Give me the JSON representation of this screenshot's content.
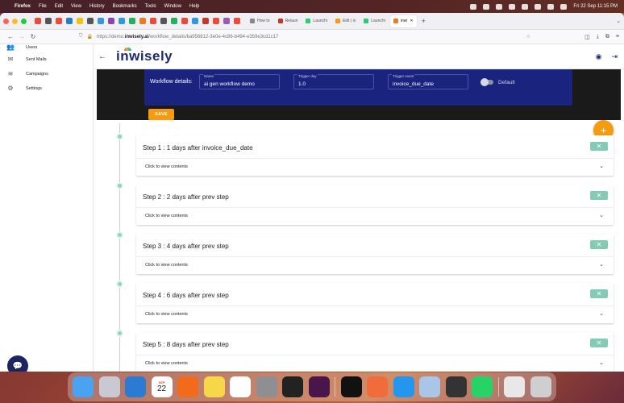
{
  "menubar": {
    "app": "Firefox",
    "menus": [
      "File",
      "Edit",
      "View",
      "History",
      "Bookmarks",
      "Tools",
      "Window",
      "Help"
    ],
    "clock": "Fri 22 Sep  11:15 PM"
  },
  "browser": {
    "tabs": [
      {
        "label": "How to",
        "color": "#888"
      },
      {
        "label": "Relaun",
        "color": "#c0392b"
      },
      {
        "label": "Launchi",
        "color": "#2ecc71"
      },
      {
        "label": "Edit | ix",
        "color": "#f39c12"
      },
      {
        "label": "Launchi",
        "color": "#2ecc71"
      },
      {
        "label": "inwi",
        "color": "#e67e22"
      }
    ],
    "pinned_colors": [
      "#e74c3c",
      "#555",
      "#e74c3c",
      "#2980b9",
      "#f1c40f",
      "#555",
      "#3498db",
      "#8e44ad",
      "#3498db",
      "#27ae60",
      "#e67e22",
      "#e74c3c",
      "#555",
      "#27ae60",
      "#e74c3c",
      "#3498db",
      "#c0392b",
      "#e74c3c",
      "#9b59b6",
      "#e74c3c"
    ],
    "url_prefix": "https://demo.",
    "url_domain": "inwisely.ai",
    "url_path": "/workflow_details/ba956812-3e0e-4c86-b494-e359e3cd1c17"
  },
  "sidebar": {
    "items": [
      {
        "label": "Users",
        "icon": "users-icon"
      },
      {
        "label": "Sent Mails",
        "icon": "mail-icon"
      },
      {
        "label": "Campaigns",
        "icon": "campaigns-icon"
      },
      {
        "label": "Settings",
        "icon": "gear-icon"
      }
    ]
  },
  "header": {
    "logo": "inwisely"
  },
  "workflow": {
    "details_label": "Workflow details:",
    "name_label": "Name",
    "name_value": "ai gen workflow demo",
    "trigger_day_label": "Trigger day",
    "trigger_day_value": "1.0",
    "trigger_event_label": "Trigger event",
    "trigger_event_value": "invoice_due_date",
    "default_label": "Default",
    "default_on": false,
    "save_label": "SAVE",
    "add_label": "+"
  },
  "steps": [
    {
      "title": "Step 1 : 1 days after invoice_due_date",
      "content": "Click to view contents"
    },
    {
      "title": "Step 2 : 2 days after prev step",
      "content": "Click to view contents"
    },
    {
      "title": "Step 3 : 4 days after prev step",
      "content": "Click to view contents"
    },
    {
      "title": "Step 4 : 6 days after prev step",
      "content": "Click to view contents"
    },
    {
      "title": "Step 5 : 8 days after prev step",
      "content": "Click to view contents"
    }
  ],
  "colors": {
    "accent": "#f59b0f",
    "panel": "#1a237e",
    "step_dot": "#8fd3c0",
    "close_button": "#84cbb6"
  },
  "dock": {
    "calendar_month": "SEP",
    "calendar_day": "22",
    "apps": [
      "finder",
      "launchpad",
      "vscode",
      "calendar",
      "firefox",
      "notes",
      "freeform",
      "system-settings",
      "terminal",
      "slack",
      "webstorm",
      "postman",
      "docker",
      "preview",
      "terminal-2",
      "whatsapp",
      "printer",
      "trash"
    ]
  }
}
